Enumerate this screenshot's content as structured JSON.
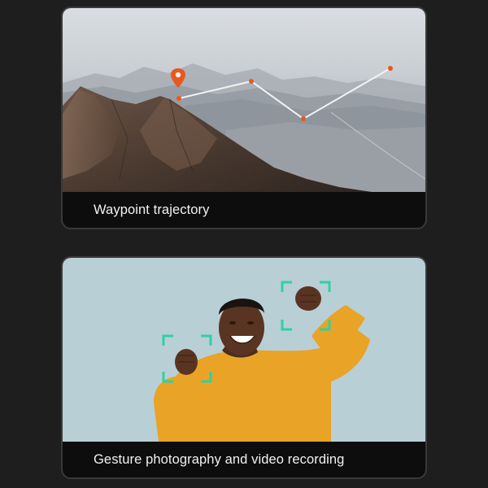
{
  "cards": [
    {
      "caption": "Waypoint trajectory",
      "image": "mountain-landscape-with-waypoint-route",
      "icons": [
        "map-pin-icon",
        "waypoint-dot-icon"
      ],
      "colors": {
        "route": "#f2f2f2",
        "waypoint": "#e8581f",
        "pin": "#e8581f"
      }
    },
    {
      "caption": "Gesture photography and video recording",
      "image": "person-raising-fists-in-yellow-sweater",
      "icons": [
        "focus-frame-icon"
      ],
      "colors": {
        "focus_frame": "#2fd1a3",
        "background": "#b9cfd6",
        "sweater": "#e9a326"
      }
    }
  ]
}
